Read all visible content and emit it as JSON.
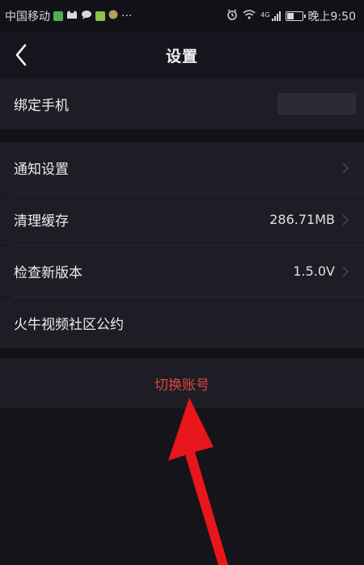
{
  "status_bar": {
    "carrier": "中国移动",
    "more": "···",
    "time": "晚上9:50",
    "signal_label": "4G"
  },
  "nav": {
    "title": "设置"
  },
  "rows": [
    {
      "label": "绑定手机",
      "value": ""
    },
    {
      "label": "通知设置",
      "value": ""
    },
    {
      "label": "清理缓存",
      "value": "286.71MB"
    },
    {
      "label": "检查新版本",
      "value": "1.5.0V"
    },
    {
      "label": "火牛视频社区公约",
      "value": ""
    }
  ],
  "switch_account": {
    "label": "切换账号"
  },
  "colors": {
    "background": "#16151d",
    "row_background": "#1e1d26",
    "accent_red": "#e0463c"
  },
  "icons": [
    "back-icon",
    "chevron-right-icon",
    "alarm-icon",
    "wifi-icon",
    "signal-icon",
    "battery-icon"
  ]
}
